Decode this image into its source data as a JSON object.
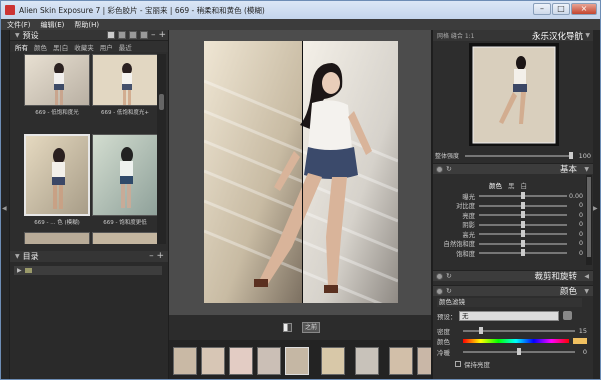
{
  "window": {
    "title": "Alien Skin Exposure 7 | 彩色胶片 - 宝丽来 | 669 - 稍柔和和黄色 (模糊)"
  },
  "menu": [
    "文件(F)",
    "编辑(E)",
    "帮助(H)"
  ],
  "presets": {
    "title": "预设",
    "tabs": [
      "所有",
      "颜色",
      "黑|白",
      "收藏夹",
      "用户",
      "最近"
    ],
    "thumbs": [
      {
        "label": "669 - 低饱和度光"
      },
      {
        "label": "669 - 低饱和度光+"
      },
      {
        "label": "669 - ... 色 (模糊)"
      },
      {
        "label": "669 - 饱和度更低"
      }
    ]
  },
  "directory": {
    "title": "目录"
  },
  "center": {
    "before_label": "之前"
  },
  "nav": {
    "tabs": "网格 缝合 1:1",
    "title": "永乐汉化导航"
  },
  "strength": {
    "label": "整体强度",
    "value": "100",
    "pct": 1.0
  },
  "basic": {
    "title": "基本",
    "subtabs": [
      "颜色",
      "黑",
      "白"
    ],
    "rows": [
      {
        "label": "曝光",
        "value": "0.00",
        "pos": 0.5
      },
      {
        "label": "对比度",
        "value": "0",
        "pos": 0.5
      },
      {
        "label": "亮度",
        "value": "0",
        "pos": 0.5
      },
      {
        "label": "阴影",
        "value": "0",
        "pos": 0.5
      },
      {
        "label": "高光",
        "value": "0",
        "pos": 0.5
      },
      {
        "label": "自然饱和度",
        "value": "0",
        "pos": 0.5
      },
      {
        "label": "饱和度",
        "value": "0",
        "pos": 0.5
      }
    ]
  },
  "crop": {
    "title": "裁剪和旋转"
  },
  "color": {
    "title": "颜色",
    "filter_label": "颜色滤镜",
    "preset_label": "预设：",
    "preset_value": "无",
    "density_label": "密度",
    "density_value": "15",
    "color_label": "颜色",
    "cool_label": "冷暖",
    "cool_value": "0",
    "preserve_label": "保持亮度"
  }
}
